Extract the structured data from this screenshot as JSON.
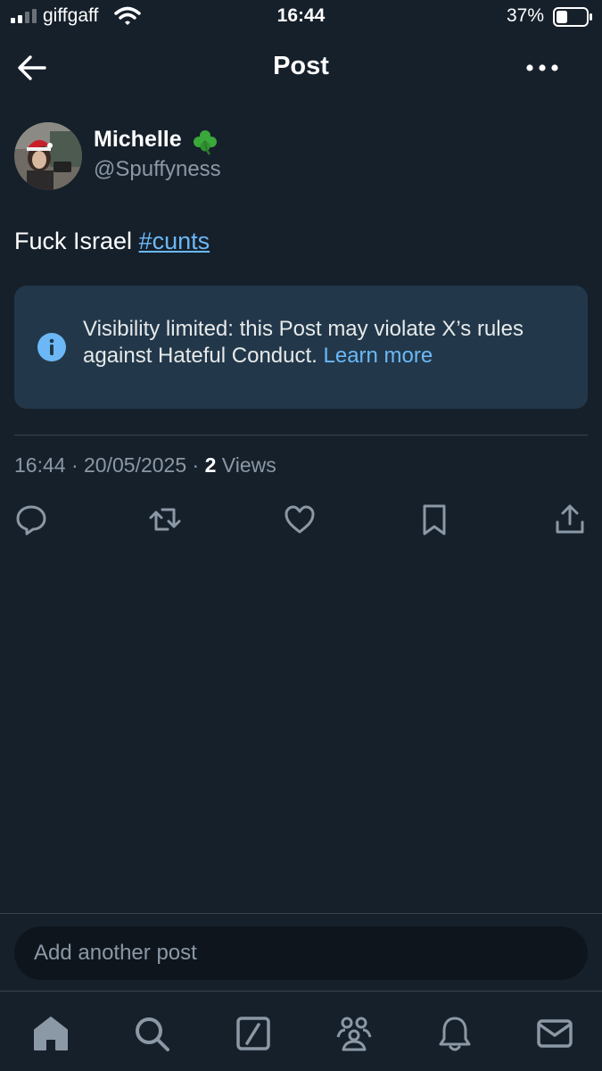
{
  "status_bar": {
    "carrier": "giffgaff",
    "time": "16:44",
    "battery_percent": "37%",
    "battery_level": 0.37
  },
  "header": {
    "title": "Post",
    "back_icon": "arrow-left-icon",
    "more_icon": "more-horizontal-icon"
  },
  "post": {
    "author_name": "Michelle",
    "author_emoji": "shamrock",
    "author_handle": "@Spuffyness",
    "text_plain": "Fuck Israel",
    "hashtag": "#cunts",
    "notice": {
      "text": "Visibility limited: this Post may violate X’s rules against Hateful Conduct.",
      "link": "Learn more"
    },
    "meta": {
      "time": "16:44",
      "date": "20/05/2025",
      "views_count": "2",
      "views_label": "Views"
    },
    "actions": [
      "reply-icon",
      "repost-icon",
      "like-icon",
      "bookmark-icon",
      "share-icon"
    ]
  },
  "reply_bar": {
    "placeholder": "Add another post"
  },
  "bottom_nav": [
    "home-icon",
    "search-icon",
    "grok-icon",
    "communities-icon",
    "notifications-icon",
    "messages-icon"
  ],
  "colors": {
    "background": "#16202b",
    "accent": "#6cb8f7",
    "notice_bg": "#22384a",
    "secondary_text": "#8b98a5"
  }
}
